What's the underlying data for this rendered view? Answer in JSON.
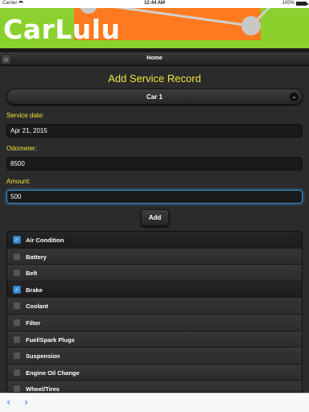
{
  "status": {
    "carrier": "Carrier",
    "time": "12:44 AM",
    "battery": "100%"
  },
  "banner": {
    "logo": "CarLulu"
  },
  "nav": {
    "home_icon": "home-icon",
    "title": "Home"
  },
  "form": {
    "heading": "Add Service Record",
    "car_select": {
      "value": "Car 1",
      "icon": "chevron-down-icon"
    },
    "service_date": {
      "label": "Service date:",
      "value": "Apr 21, 2015"
    },
    "odometer": {
      "label": "Odometer:",
      "value": "8500"
    },
    "amount": {
      "label": "Amount:",
      "value": "500"
    },
    "add_label": "Add"
  },
  "services": [
    {
      "label": "Air Condition",
      "checked": true
    },
    {
      "label": "Battery",
      "checked": false
    },
    {
      "label": "Belt",
      "checked": false
    },
    {
      "label": "Brake",
      "checked": true
    },
    {
      "label": "Coolant",
      "checked": false
    },
    {
      "label": "Filter",
      "checked": false
    },
    {
      "label": "Fuel/Spark Plugs",
      "checked": false
    },
    {
      "label": "Suspension",
      "checked": false
    },
    {
      "label": "Engine Oil Change",
      "checked": false
    },
    {
      "label": "Wheel/Tires",
      "checked": false
    }
  ],
  "footer": {
    "back_icon": "back-arrow-icon",
    "forward_icon": "forward-arrow-icon"
  },
  "colors": {
    "accent": "#f0e43c",
    "banner_green": "#8ad12e",
    "banner_orange": "#ff7a1f",
    "check_blue": "#3b8fd9"
  }
}
